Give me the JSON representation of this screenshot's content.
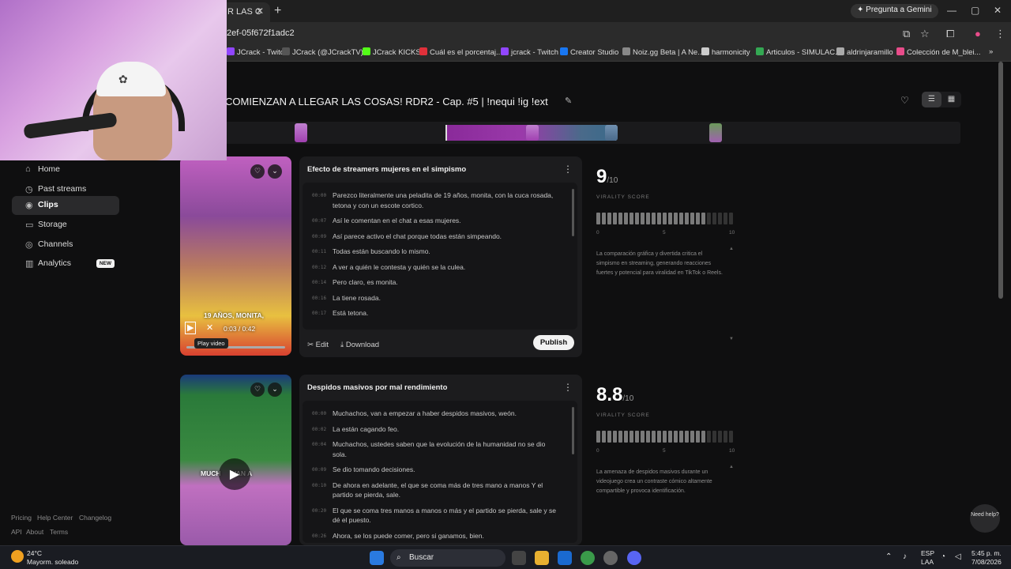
{
  "browser": {
    "tab_title": "R LAS C",
    "url": "2ef-05f672f1adc2",
    "gemini_label": "Pregunta a Gemini",
    "bookmarks": [
      {
        "label": "JCrack - Twitch",
        "color": "#9146ff"
      },
      {
        "label": "JCrack (@JCrackTV)...",
        "color": "#555555"
      },
      {
        "label": "JCrack KICKS",
        "color": "#53fc18"
      },
      {
        "label": "Cuál es el porcentaj...",
        "color": "#e0303a"
      },
      {
        "label": "jcrack - Twitch",
        "color": "#9146ff"
      },
      {
        "label": "Creator Studio",
        "color": "#1877f2"
      },
      {
        "label": "Noiz.gg Beta | A Ne...",
        "color": "#888888"
      },
      {
        "label": "harmonicity",
        "color": "#cccccc"
      },
      {
        "label": "Articulos - SIMULAC...",
        "color": "#34a853"
      },
      {
        "label": "aldrinjaramillo",
        "color": "#aaaaaa"
      },
      {
        "label": "Colección de M_blei...",
        "color": "#e84c8a"
      }
    ]
  },
  "sidebar": {
    "items": [
      {
        "label": "Home",
        "icon": "home-icon",
        "glyph": "⌂"
      },
      {
        "label": "Past streams",
        "icon": "history-icon",
        "glyph": "◷"
      },
      {
        "label": "Clips",
        "icon": "clips-icon",
        "glyph": "◉",
        "active": true
      },
      {
        "label": "Storage",
        "icon": "storage-icon",
        "glyph": "▭"
      },
      {
        "label": "Channels",
        "icon": "channels-icon",
        "glyph": "◎"
      },
      {
        "label": "Analytics",
        "icon": "analytics-icon",
        "glyph": "▥",
        "badge": "NEW"
      }
    ],
    "footer_row1": [
      "Pricing",
      "Help Center",
      "Changelog"
    ],
    "footer_row2": [
      "API",
      "About",
      "Terms"
    ]
  },
  "page": {
    "title": "COMIENZAN A LLEGAR LAS COSAS! RDR2 - Cap. #5 | !nequi !ig !ext"
  },
  "clips": [
    {
      "title": "Efecto de streamers mujeres en el simpismo",
      "video_caption": "19 AÑOS, MONITA,",
      "video_time": "0:03 / 0:42",
      "tooltip": "Play video",
      "transcript": [
        {
          "t": "00:00",
          "text": "Parezco literalmente una peladita de 19 años, monita, con la cuca rosada, tetona y con un escote cortico."
        },
        {
          "t": "00:07",
          "text": "Así le comentan en el chat a esas mujeres."
        },
        {
          "t": "00:09",
          "text": "Así parece activo el chat porque todas están simpeando."
        },
        {
          "t": "00:11",
          "text": "Todas están buscando lo mismo."
        },
        {
          "t": "00:12",
          "text": "A ver a quién le contesta y quién se la culea."
        },
        {
          "t": "00:14",
          "text": "Pero claro, es monita."
        },
        {
          "t": "00:16",
          "text": "La tiene rosada."
        },
        {
          "t": "00:17",
          "text": "Está tetona."
        }
      ],
      "edit_label": "Edit",
      "download_label": "Download",
      "publish_label": "Publish",
      "score": "9",
      "score_den": "/10",
      "score_value": 9,
      "virality_label": "VIRALITY SCORE",
      "ticks": [
        "0",
        "5",
        "10"
      ],
      "description": "La comparación gráfica y divertida critica el simpismo en streaming, generando reacciones fuertes y potencial para viralidad en TikTok o Reels."
    },
    {
      "title": "Despidos masivos por mal rendimiento",
      "video_caption": "MUCH      VAN A",
      "transcript": [
        {
          "t": "00:00",
          "text": "Muchachos, van a empezar a haber despidos masivos, weón."
        },
        {
          "t": "00:02",
          "text": "La están cagando feo."
        },
        {
          "t": "00:04",
          "text": "Muchachos, ustedes saben que la evolución de la humanidad no se dio sola."
        },
        {
          "t": "00:09",
          "text": "Se dio tomando decisiones."
        },
        {
          "t": "00:10",
          "text": "De ahora en adelante, el que se coma más de tres mano a manos Y el partido se pierda, sale."
        },
        {
          "t": "00:20",
          "text": "El que se coma tres manos a manos o más y el partido se pierda, sale y se dé el puesto."
        },
        {
          "t": "00:26",
          "text": "Ahora, se los puede comer, pero si ganamos, bien."
        }
      ],
      "score": "8.8",
      "score_den": "/10",
      "score_value": 8.8,
      "virality_label": "VIRALITY SCORE",
      "ticks": [
        "0",
        "5",
        "10"
      ],
      "description": "La amenaza de despidos masivos durante un videojuego crea un contraste cómico altamente compartible y provoca identificación."
    }
  ],
  "help_button": "Need help?",
  "taskbar": {
    "temp": "24°C",
    "weather": "Mayorm. soleado",
    "search_placeholder": "Buscar",
    "lang1": "ESP",
    "lang2": "LAA",
    "time": "5:45 p. m.",
    "date": "7/08/2026"
  }
}
